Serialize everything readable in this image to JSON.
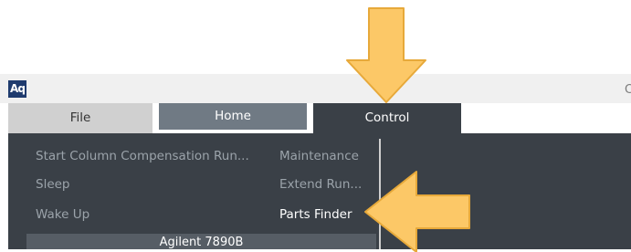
{
  "app": {
    "logo_text": "Aq",
    "cut_title_text": "C"
  },
  "tabs": [
    {
      "label": "File"
    },
    {
      "label": "Home"
    },
    {
      "label": "Control"
    }
  ],
  "menu": {
    "left_items": [
      {
        "label": "Start Column Compensation Run..."
      },
      {
        "label": "Sleep"
      },
      {
        "label": "Wake Up"
      }
    ],
    "right_items": [
      {
        "label": "Maintenance"
      },
      {
        "label": "Extend Run..."
      },
      {
        "label": "Parts Finder"
      }
    ],
    "group_label": "Agilent 7890B"
  },
  "colors": {
    "tab_active": "#3a4047",
    "arrow_fill": "#fcc867",
    "arrow_stroke": "#e7a93a"
  }
}
